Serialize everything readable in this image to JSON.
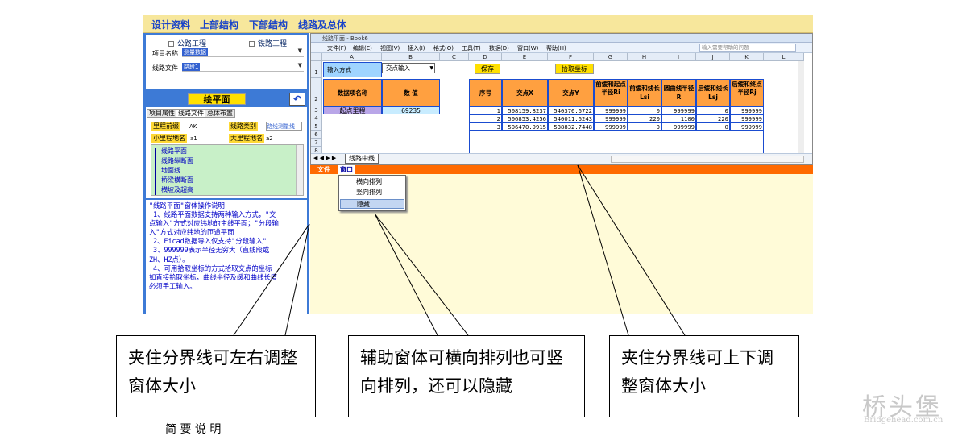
{
  "menu": [
    "设计资料",
    "上部结构",
    "下部结构",
    "线路及总体"
  ],
  "left": {
    "checks": [
      "公路工程",
      "铁路工程"
    ],
    "project_label": "项目名称",
    "project_value": "测量数据",
    "route_label": "线路文件",
    "route_value": "路段1",
    "draw_btn": "绘平面",
    "tabs": [
      "项目属性",
      "线路文件",
      "总体布置"
    ],
    "prefix_label": "里程前缀",
    "prefix_value": "AK",
    "type_label": "线路类别",
    "type_value": "路线测量线",
    "small_label": "小里程地名",
    "small_value": "a1",
    "big_label": "大里程地名",
    "big_value": "a2",
    "tree": [
      "线路平面",
      "线路纵断面",
      "地面线",
      "桥梁横断面",
      "横坡及超高"
    ],
    "help": "\"线路平面\"窗体操作说明\n 1、线路平面数据支持两种输入方式，\"交\n点输入\"方式对应纬地的主线平面；\"分段输\n入\"方式对应纬地的匝道平面\n 2、Eicad数据导入仅支持\"分段输入\"\n 3、999999表示半径无穷大（直线段或\nZH、HZ点）。\n 4、可用拾取坐标的方式拾取交点的坐标\n如直接拾取坐标，曲线半径及缓和曲线长度\n必须手工输入。"
  },
  "excel": {
    "title": "线路平面 - Book6",
    "menu": [
      "文件(F)",
      "编辑(E)",
      "视图(V)",
      "插入(I)",
      "格式(O)",
      "工具(T)",
      "数据(D)",
      "窗口(W)",
      "帮助(H)"
    ],
    "help_placeholder": "输入需要帮助的问题",
    "cols": [
      "A",
      "B",
      "C",
      "D",
      "E",
      "F",
      "G",
      "H",
      "I",
      "J",
      "K",
      "L"
    ],
    "rows": [
      "1",
      "2",
      "3",
      "4",
      "5",
      "6",
      "7",
      "8",
      "9"
    ],
    "input_mode_label": "输入方式",
    "input_mode_value": "交点输入",
    "save_btn": "保存",
    "pick_btn": "拾取坐标",
    "hdr_name": "数据项名称",
    "hdr_value": "数  值",
    "hdrs": [
      "序号",
      "交点X",
      "交点Y",
      "前缓和起点半径Ri",
      "前缓和线长Lsi",
      "圆曲线半径R",
      "后缓和线长Lsj",
      "后缓和终点半径Rj"
    ],
    "start_label": "起点里程",
    "start_value": "69235",
    "data": [
      [
        "1",
        "508159.8237",
        "540376.6722",
        "999999",
        "0",
        "999999",
        "0",
        "999999"
      ],
      [
        "2",
        "506853.4256",
        "540011.6243",
        "999999",
        "220",
        "1100",
        "220",
        "999999"
      ],
      [
        "3",
        "506470.9915",
        "538832.7448",
        "999999",
        "0",
        "999999",
        "0",
        "999999"
      ]
    ],
    "sheet_tab": "线路中线"
  },
  "orange_menu": [
    "文件",
    "窗口"
  ],
  "popup": [
    "横向排列",
    "竖向排列",
    "隐藏"
  ],
  "callouts": [
    "夹住分界线可左右调整窗体大小",
    "辅助窗体可横向排列也可竖向排列，还可以隐藏",
    "夹住分界线可上下调整窗体大小"
  ],
  "watermark": {
    "big": "桥头堡",
    "small": "Bridgehead.com.cn"
  },
  "bottom_text": "简 要 说 明"
}
